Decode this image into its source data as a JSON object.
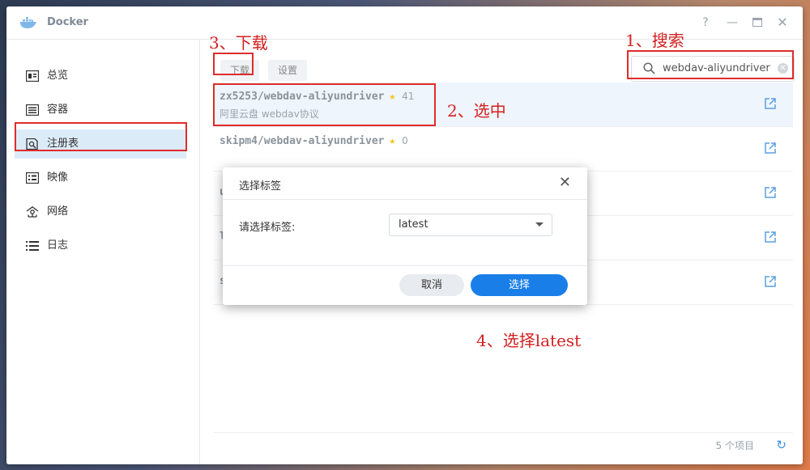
{
  "app": {
    "title": "Docker"
  },
  "sidebar": {
    "items": [
      {
        "label": "总览",
        "icon": "overview-icon"
      },
      {
        "label": "容器",
        "icon": "container-icon"
      },
      {
        "label": "注册表",
        "icon": "registry-icon",
        "active": true
      },
      {
        "label": "映像",
        "icon": "image-icon"
      },
      {
        "label": "网络",
        "icon": "network-icon"
      },
      {
        "label": "日志",
        "icon": "log-icon"
      }
    ]
  },
  "toolbar": {
    "download_label": "下载",
    "settings_label": "设置"
  },
  "search": {
    "value": "webdav-aliyundriver"
  },
  "results": [
    {
      "name": "zx5253/webdav-aliyundriver",
      "stars": "41",
      "desc": "阿里云盘 webdav协议"
    },
    {
      "name": "skipm4/webdav-aliyundriver",
      "stars": "0",
      "desc": ""
    },
    {
      "name": "u"
    },
    {
      "name": "l"
    },
    {
      "name": "s"
    }
  ],
  "footer": {
    "count": "5 个项目"
  },
  "dialog": {
    "title": "选择标签",
    "label": "请选择标签:",
    "selected_tag": "latest",
    "cancel": "取消",
    "confirm": "选择"
  },
  "annotations": {
    "step1": "1、搜索",
    "step2": "2、选中",
    "step3": "3、下载",
    "step4": "4、选择latest"
  },
  "colors": {
    "accent": "#1a7ee8",
    "annotation": "#e02b2b",
    "active_nav": "#dcebf8"
  }
}
